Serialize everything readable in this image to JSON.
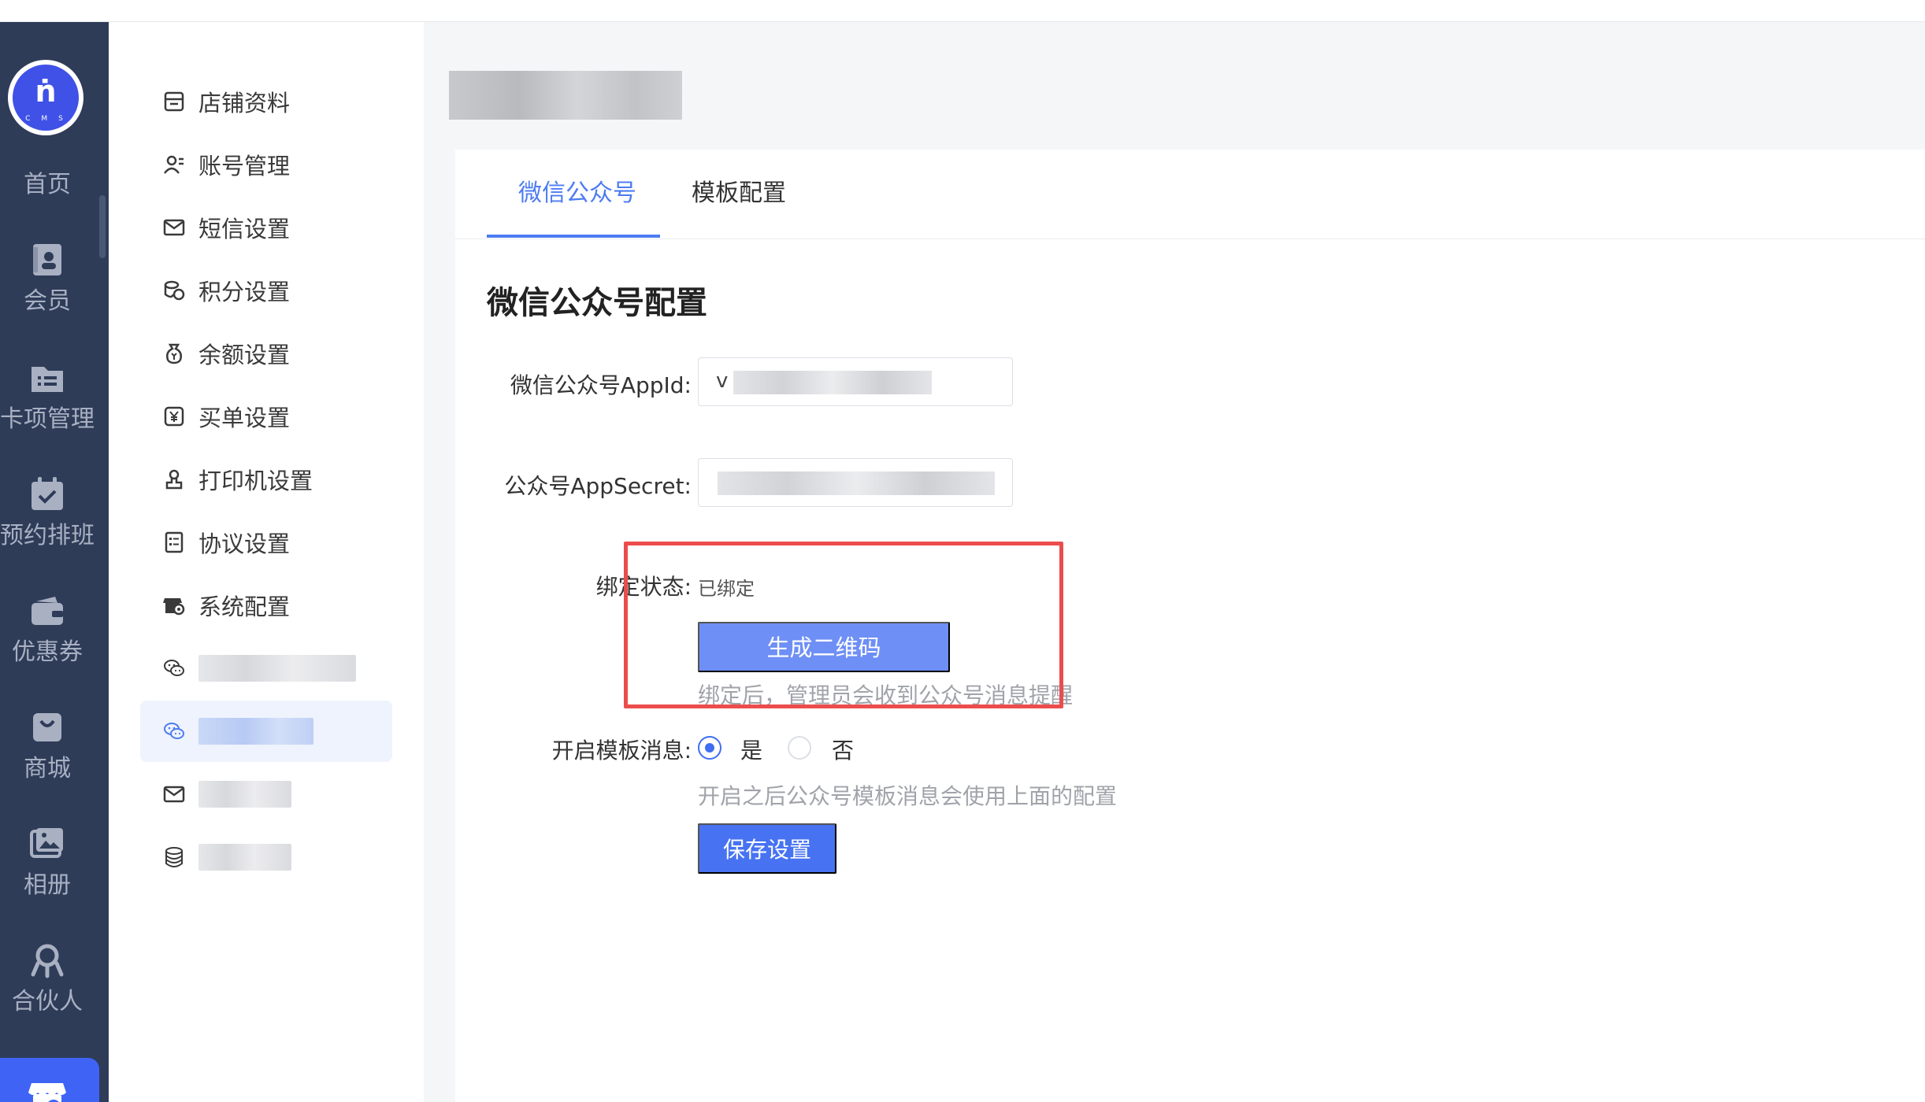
{
  "app": {
    "logo_mark": "ṅ",
    "logo_sub": "CMS"
  },
  "nav": {
    "items": [
      {
        "label": "首页",
        "icon": "home-icon"
      },
      {
        "label": "会员",
        "icon": "member-icon"
      },
      {
        "label": "卡项管理",
        "icon": "card-folder-icon"
      },
      {
        "label": "预约排班",
        "icon": "calendar-check-icon"
      },
      {
        "label": "优惠券",
        "icon": "coupon-wallet-icon"
      },
      {
        "label": "商城",
        "icon": "shopping-bag-icon"
      },
      {
        "label": "相册",
        "icon": "gallery-icon"
      },
      {
        "label": "合伙人",
        "icon": "partner-icon"
      }
    ],
    "active_icon": "store-settings-icon"
  },
  "submenu": {
    "items": [
      {
        "label": "店铺资料",
        "icon": "store-icon"
      },
      {
        "label": "账号管理",
        "icon": "account-icon"
      },
      {
        "label": "短信设置",
        "icon": "mail-icon"
      },
      {
        "label": "积分设置",
        "icon": "points-icon"
      },
      {
        "label": "余额设置",
        "icon": "balance-icon"
      },
      {
        "label": "买单设置",
        "icon": "yen-icon"
      },
      {
        "label": "打印机设置",
        "icon": "printer-icon"
      },
      {
        "label": "协议设置",
        "icon": "agreement-icon"
      },
      {
        "label": "系统配置",
        "icon": "system-icon"
      }
    ]
  },
  "tabs": [
    {
      "label": "微信公众号"
    },
    {
      "label": "模板配置"
    }
  ],
  "form": {
    "title": "微信公众号配置",
    "appid_label": "微信公众号AppId:",
    "appid_value": "v",
    "secret_label": "公众号AppSecret:",
    "bind_label": "绑定状态:",
    "bind_value": "已绑定",
    "qr_button": "生成二维码",
    "bind_hint": "绑定后，管理员会收到公众号消息提醒",
    "template_label": "开启模板消息:",
    "option_yes": "是",
    "option_no": "否",
    "template_hint": "开启之后公众号模板消息会使用上面的配置",
    "save_button": "保存设置"
  },
  "colors": {
    "nav_bg": "#2e3c58",
    "primary": "#4773f2",
    "tab_active": "#4d7cf2",
    "highlight_box": "#ec4c4c"
  }
}
